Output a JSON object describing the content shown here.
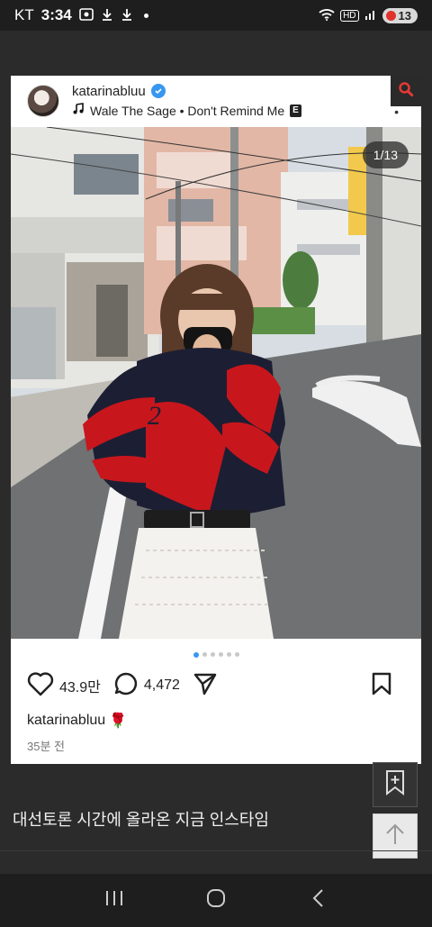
{
  "status_bar": {
    "carrier": "KT",
    "time": "3:34",
    "network": "HD",
    "battery": "13"
  },
  "post": {
    "username": "katarinabluu",
    "music": "Wale The Sage • Don't Remind Me",
    "explicit_badge": "E",
    "photo_counter": "1/13",
    "carousel_total": 6,
    "carousel_active": 0,
    "likes": "43.9만",
    "comments": "4,472",
    "caption_user": "katarinabluu",
    "caption_emoji": "🌹",
    "time_ago": "35분 전"
  },
  "article": {
    "title": "대선토론 시간에 올라온 지금 인스타임"
  },
  "colors": {
    "verified": "#3897f0",
    "background": "#2b2b2b",
    "jacket_red": "#c8161d",
    "jacket_navy": "#1c1f33"
  },
  "icons": {
    "like": "heart-icon",
    "comment": "comment-icon",
    "share": "send-icon",
    "save": "bookmark-icon",
    "music": "music-note-icon",
    "search": "search-icon"
  }
}
